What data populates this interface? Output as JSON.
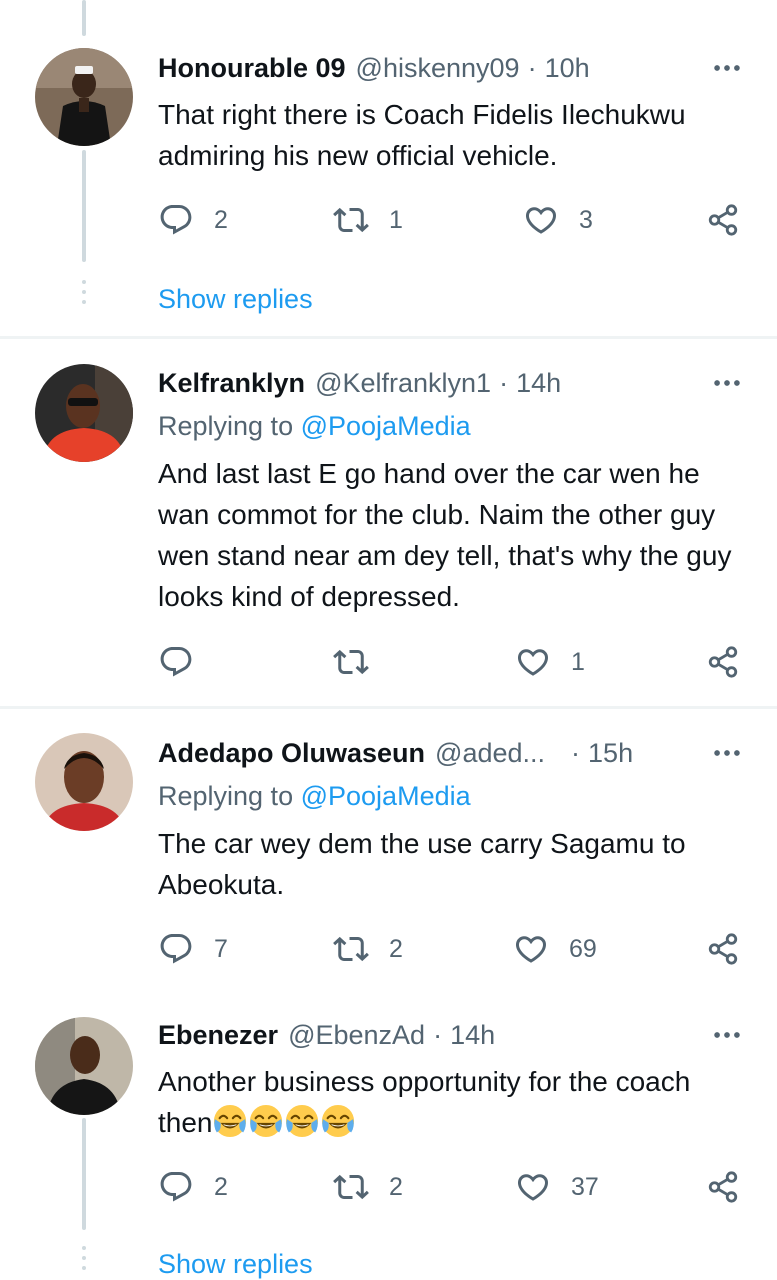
{
  "tweets": [
    {
      "name": "Honourable 09",
      "handle": "@hiskenny09",
      "sep": "·",
      "time": "10h",
      "text": "That right there is Coach Fidelis Ilechukwu admiring his new official vehicle.",
      "replies": "2",
      "retweets": "1",
      "likes": "3",
      "show_replies": "Show replies"
    },
    {
      "name": "Kelfranklyn",
      "handle": "@Kelfranklyn1",
      "sep": "·",
      "time": "14h",
      "replying_prefix": "Replying to",
      "replying_to": "@PoojaMedia",
      "text": "And last last E go hand over the car wen he wan commot for the club. Naim the other guy wen stand near am dey tell, that's why the guy looks kind of depressed.",
      "replies": "",
      "retweets": "",
      "likes": "1"
    },
    {
      "name": "Adedapo Oluwaseun",
      "handle": "@aded...",
      "sep": "·",
      "time": "15h",
      "replying_prefix": "Replying to",
      "replying_to": "@PoojaMedia",
      "text": "The car wey dem the use carry Sagamu to Abeokuta.",
      "replies": "7",
      "retweets": "2",
      "likes": "69"
    },
    {
      "name": "Ebenezer",
      "handle": "@EbenzAd",
      "sep": "·",
      "time": "14h",
      "text": "Another business opportunity for the coach then",
      "emoji_count": 4,
      "replies": "2",
      "retweets": "2",
      "likes": "37",
      "show_replies": "Show replies"
    }
  ],
  "icons": {
    "reply": "reply-icon",
    "retweet": "retweet-icon",
    "like": "heart-icon",
    "share": "share-icon",
    "more": "more-icon",
    "emoji": "face-with-tears-of-joy-icon"
  },
  "colors": {
    "link": "#1d9bf0",
    "secondary": "#536471",
    "thread_line": "#cfd9de",
    "divider": "#eff3f4"
  }
}
